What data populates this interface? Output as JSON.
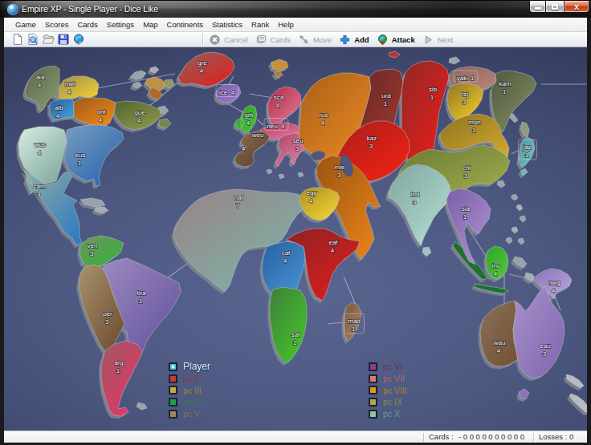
{
  "window": {
    "title": "Empire XP - Single Player - Dice Like",
    "controls": {
      "minimize": "minimize",
      "maximize": "maximize",
      "close": "x"
    }
  },
  "menu": {
    "items": [
      "Game",
      "Scores",
      "Cards",
      "Settings",
      "Map",
      "Continents",
      "Statistics",
      "Rank",
      "Help"
    ]
  },
  "toolbar": {
    "file_icons": [
      "new-document-icon",
      "print-preview-icon",
      "open-folder-icon",
      "save-icon",
      "world-icon"
    ],
    "action_buttons": [
      {
        "label": "Cancel",
        "icon": "cancel-icon",
        "enabled": false
      },
      {
        "label": "Cards",
        "icon": "cards-icon",
        "enabled": false
      },
      {
        "label": "Move",
        "icon": "move-icon",
        "enabled": false
      },
      {
        "label": "Add",
        "icon": "add-plus-icon",
        "enabled": true
      },
      {
        "label": "Attack",
        "icon": "attack-globe-icon",
        "enabled": true
      },
      {
        "label": "Next",
        "icon": "next-play-icon",
        "enabled": false
      }
    ]
  },
  "map": {
    "territories": [
      {
        "id": "ala",
        "armies": "4",
        "c1": "#5c664d",
        "c2": "#879a6a"
      },
      {
        "id": "nwt",
        "armies": "4",
        "c1": "#a28d4c",
        "c2": "#f4d232"
      },
      {
        "id": "alb",
        "armies": "4",
        "c1": "#2a5f9e",
        "c2": "#42a0dc"
      },
      {
        "id": "ont",
        "armies": "4",
        "c1": "#a05a1a",
        "c2": "#f08818"
      },
      {
        "id": "que",
        "armies": "4",
        "c1": "#55632f",
        "c2": "#8a9a4a"
      },
      {
        "id": "gre",
        "armies": "4",
        "c1": "#8f6058",
        "c2": "#e02020"
      },
      {
        "id": "wus",
        "armies": "4",
        "c1": "#d8ece2",
        "c2": "#7fa99a"
      },
      {
        "id": "eus",
        "armies": "1",
        "c1": "#7a9cc0",
        "c2": "#2565ae"
      },
      {
        "id": "cam",
        "armies": "3",
        "c1": "#8fae9f",
        "c2": "#2f7ac4"
      },
      {
        "id": "ven",
        "armies": "3",
        "c1": "#6f965e",
        "c2": "#34b03c"
      },
      {
        "id": "bra",
        "armies": "1",
        "c1": "#9b8ac0",
        "c2": "#64519e"
      },
      {
        "id": "per",
        "armies": "3",
        "c1": "#a8916a",
        "c2": "#6e4f33"
      },
      {
        "id": "arg",
        "armies": "1",
        "c1": "#9e5a62",
        "c2": "#e63368"
      },
      {
        "id": "ice",
        "armies": "4",
        "c1": "#7a5aaa",
        "c2": "#9a7ac8",
        "boxed": "inline"
      },
      {
        "id": "grb",
        "armies": "4",
        "c1": "#2a9e2a",
        "c2": "#4ac43a"
      },
      {
        "id": "sca",
        "armies": "4",
        "c1": "#ae3048",
        "c2": "#e57795"
      },
      {
        "id": "neu",
        "armies": "4",
        "c1": "#b03a60",
        "c2": "#e878a2",
        "boxed": "inline"
      },
      {
        "id": "weu",
        "armies": "4",
        "c1": "#8a6a4e",
        "c2": "#5f4330"
      },
      {
        "id": "seu",
        "armies": "3",
        "c1": "#a84868",
        "c2": "#e87ea6"
      },
      {
        "id": "rus",
        "armies": "4",
        "c1": "#a86018",
        "c2": "#ea8822"
      },
      {
        "id": "ura",
        "armies": "1",
        "c1": "#6a2626",
        "c2": "#a03c30"
      },
      {
        "id": "sib",
        "armies": "1",
        "c1": "#8f2a24",
        "c2": "#ee1c1c"
      },
      {
        "id": "yak",
        "armies": "1",
        "c1": "#8a625a",
        "c2": "#b8867a",
        "boxed": "inline"
      },
      {
        "id": "kam",
        "armies": "1",
        "c1": "#4f5940",
        "c2": "#808f60"
      },
      {
        "id": "tsj",
        "armies": "3",
        "c1": "#8f742f",
        "c2": "#f2ce22"
      },
      {
        "id": "mon",
        "armies": "1",
        "c1": "#8f7224",
        "c2": "#d2a92c"
      },
      {
        "id": "jap",
        "armies": "1",
        "c1": "#3f8f9a",
        "c2": "#82ccc4",
        "boxed": "stack"
      },
      {
        "id": "kaz",
        "armies": "3",
        "c1": "#aa1f1a",
        "c2": "#f22114"
      },
      {
        "id": "chi",
        "armies": "3",
        "c1": "#6a7a34",
        "c2": "#a2b04e"
      },
      {
        "id": "mie",
        "armies": "3",
        "c1": "#9a5510",
        "c2": "#e8821a"
      },
      {
        "id": "ind",
        "armies": "3",
        "c1": "#7fa5a0",
        "c2": "#b4dcd0"
      },
      {
        "id": "sia",
        "armies": "1",
        "c1": "#7a5fa8",
        "c2": "#ae90d2"
      },
      {
        "id": "egy",
        "armies": "4",
        "c1": "#ad8f1f",
        "c2": "#f2d435"
      },
      {
        "id": "naf",
        "armies": "7",
        "c1": "#9a8289",
        "c2": "#7cb4a6"
      },
      {
        "id": "eaf",
        "armies": "4",
        "c1": "#8f2222",
        "c2": "#dd1f1f"
      },
      {
        "id": "caf",
        "armies": "4",
        "c1": "#2a5f9e",
        "c2": "#4593d4"
      },
      {
        "id": "saf",
        "armies": "1",
        "c1": "#3f7f3a",
        "c2": "#44c428"
      },
      {
        "id": "mad",
        "armies": "1",
        "c1": "#75583c",
        "c2": "#a8805c",
        "boxed": "stack"
      },
      {
        "id": "ino",
        "armies": "4",
        "c1": "#2fa42f",
        "c2": "#52c838"
      },
      {
        "id": "nwg",
        "armies": "4",
        "c1": "#8a74b8",
        "c2": "#bca4de"
      },
      {
        "id": "wau",
        "armies": "4",
        "c1": "#867058",
        "c2": "#755437"
      },
      {
        "id": "eau",
        "armies": "3",
        "c1": "#a892cc",
        "c2": "#7e62ac"
      }
    ]
  },
  "legend": {
    "left": [
      {
        "label": "Player",
        "swatch": "#35c8dc",
        "text_color": "#d4f0fa",
        "current": true
      },
      {
        "label": "pc II",
        "swatch": "#c43a34",
        "text_color": "#8f3434"
      },
      {
        "label": "pc III",
        "swatch": "#cfa83a",
        "text_color": "#9a8530"
      },
      {
        "label": "pc IV",
        "swatch": "#1e9e48",
        "text_color": "#3f7a48"
      },
      {
        "label": "pc V",
        "swatch": "#a08850",
        "text_color": "#7f7352"
      }
    ],
    "right": [
      {
        "label": "pc VI",
        "swatch": "#8f4080",
        "text_color": "#5f3a58"
      },
      {
        "label": "pc VII",
        "swatch": "#e0786a",
        "text_color": "#b5685f"
      },
      {
        "label": "pc VIII",
        "swatch": "#e5941f",
        "text_color": "#b07c28"
      },
      {
        "label": "pc IX",
        "swatch": "#b0a843",
        "text_color": "#8a8a45"
      },
      {
        "label": "pc X",
        "swatch": "#8fc49f",
        "text_color": "#6f9a85"
      }
    ]
  },
  "status_bar": {
    "cards_label": "Cards :",
    "cards_value": "-0000000000",
    "losses_label": "Losses :",
    "losses_value": "0"
  }
}
